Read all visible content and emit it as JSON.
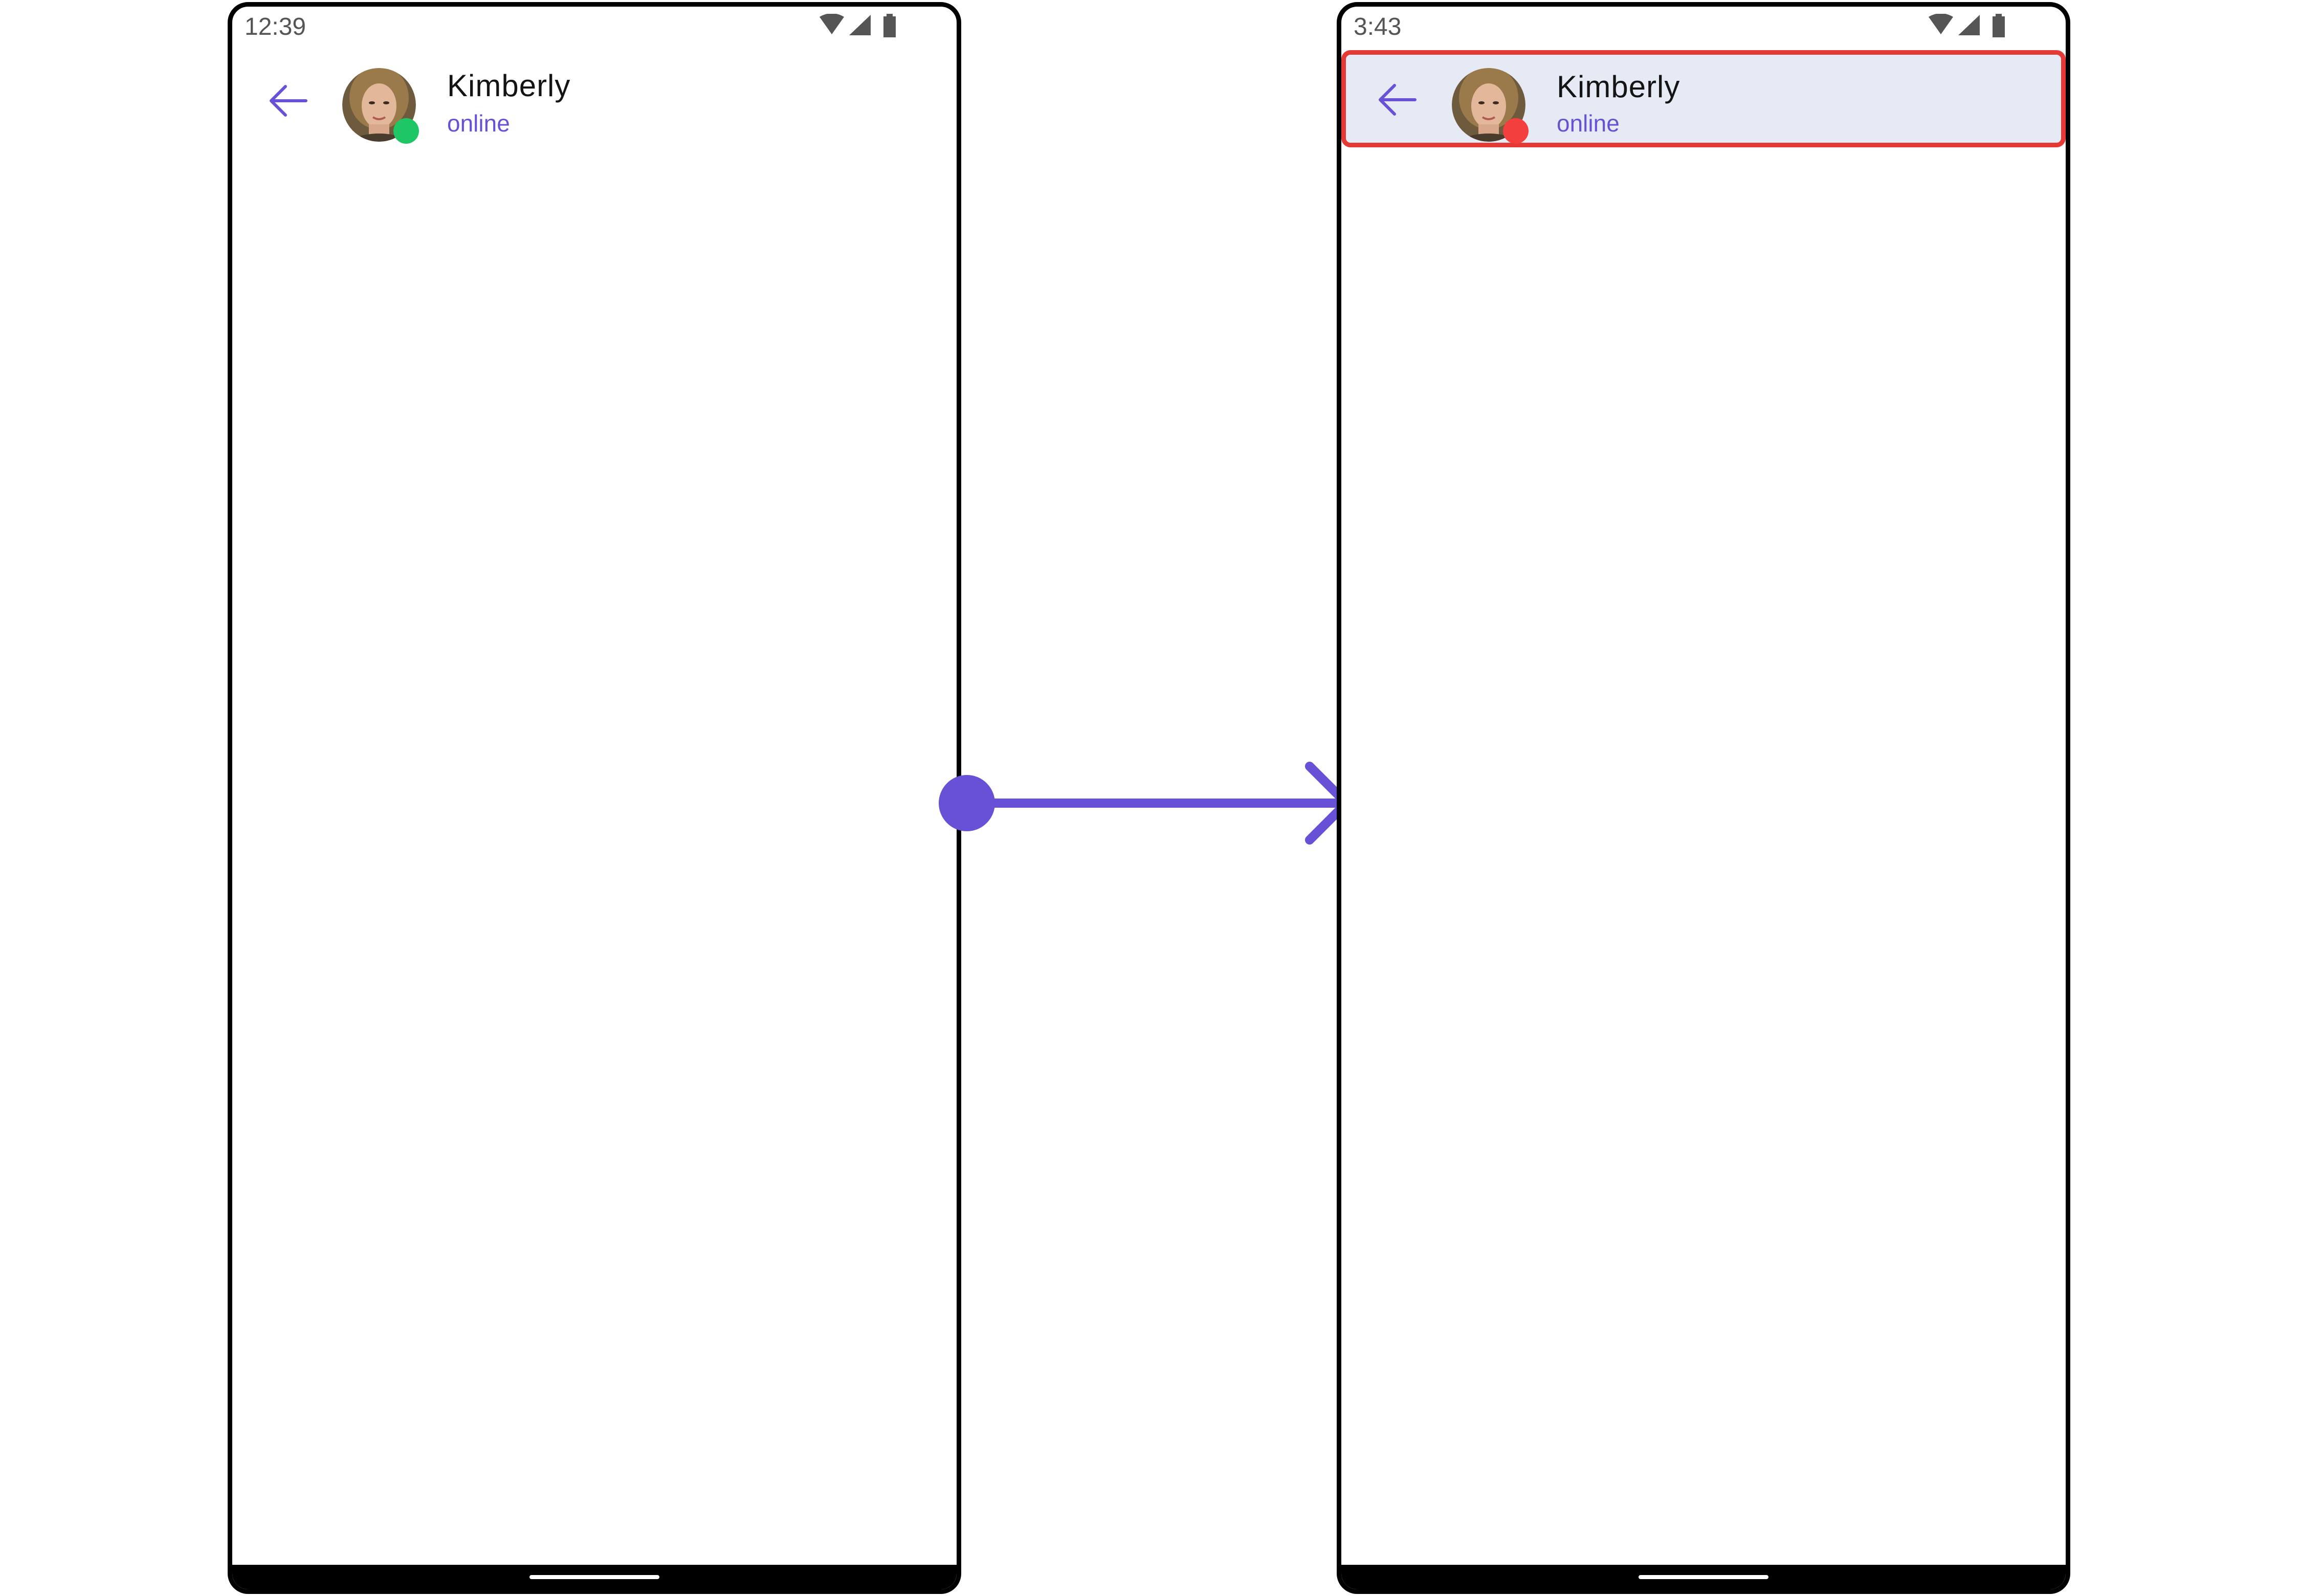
{
  "screens": [
    {
      "status_time": "12:39",
      "header": {
        "back_icon": "arrow-left-icon",
        "avatar": "user-avatar",
        "name": "Kimberly",
        "status": "online",
        "presence_color": "#1fc665"
      }
    },
    {
      "status_time": "3:43",
      "header": {
        "back_icon": "arrow-left-icon",
        "avatar": "user-avatar",
        "name": "Kimberly",
        "status": "online",
        "presence_color": "#f43f3f",
        "highlight_background": "#e6eaf5",
        "highlight_border": "#e53935"
      }
    }
  ],
  "colors": {
    "accent": "#6851d6",
    "frame": "#000000",
    "name_text": "#141414",
    "status_text": "#6851d6"
  },
  "arrow": {
    "icon": "transition-arrow-icon",
    "color": "#6851d6"
  }
}
